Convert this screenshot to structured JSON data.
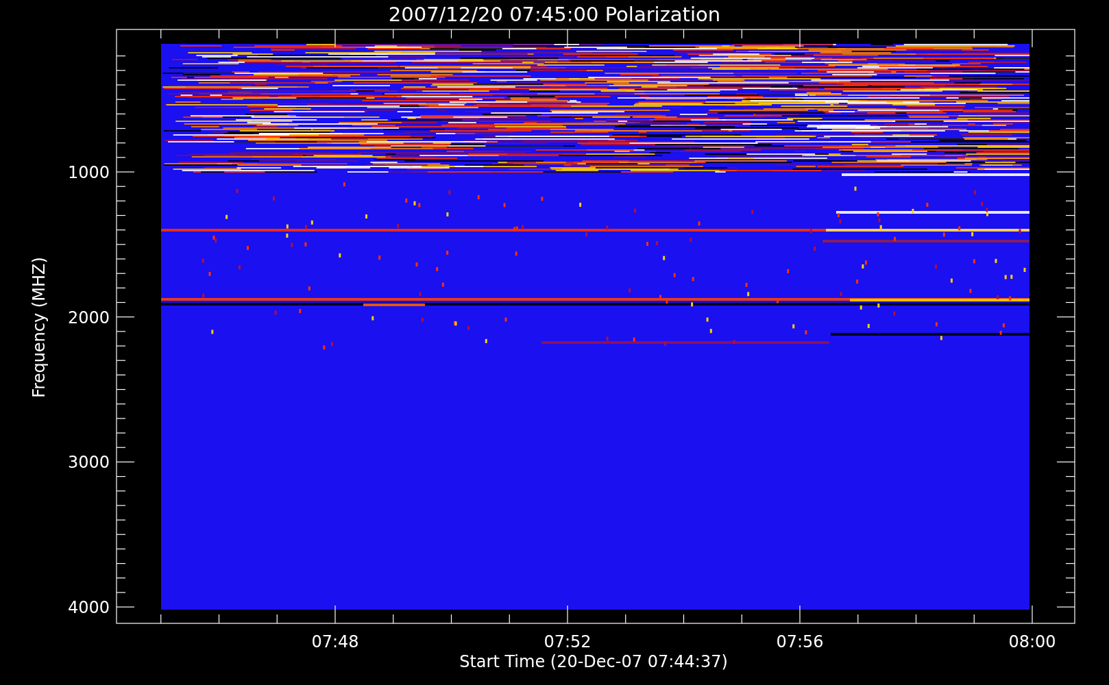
{
  "title": "2007/12/20 07:45:00 Polarization",
  "y_axis": {
    "label": "Frequency (MHZ)",
    "ticks": [
      "1000",
      "2000",
      "3000",
      "4000"
    ]
  },
  "x_axis": {
    "label": "Start Time (20-Dec-07 07:44:37)",
    "ticks": [
      "07:48",
      "07:52",
      "07:56",
      "08:00"
    ]
  }
}
